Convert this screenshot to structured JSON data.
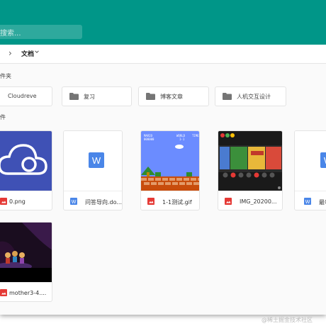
{
  "search": {
    "placeholder": "搜索..."
  },
  "breadcrumb": {
    "current": "文档"
  },
  "sections": {
    "folders": "件夹",
    "files": "件"
  },
  "folders": [
    {
      "name": "Cloudreve"
    },
    {
      "name": "复习"
    },
    {
      "name": "博客文章"
    },
    {
      "name": "人机交互设计"
    }
  ],
  "files": [
    {
      "name": "0.png",
      "icon": "image-icon"
    },
    {
      "name": "问答导向.do...",
      "icon": "word-icon"
    },
    {
      "name": "1-1测试.gif",
      "icon": "image-icon"
    },
    {
      "name": "IMG_20200...",
      "icon": "image-icon"
    },
    {
      "name": "最年",
      "icon": "word-icon"
    },
    {
      "name": "mother3-4....",
      "icon": "image-icon"
    }
  ],
  "game_screen": {
    "score_left": "MARIO\n000000",
    "score_mid": "WORLD\n1-1",
    "score_right": "TIME"
  },
  "watermark": "@稀土掘金技术社区",
  "colors": {
    "appbar": "#009688",
    "word_blue": "#4a86e8",
    "image_red": "#e53935"
  }
}
